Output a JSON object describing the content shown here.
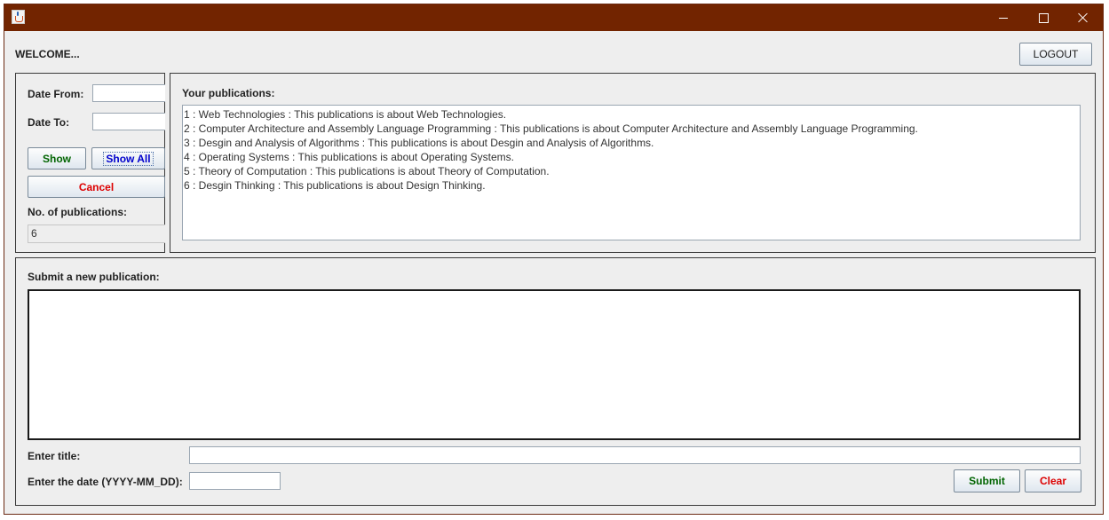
{
  "window": {
    "app_icon": "java-coffee-cup-icon",
    "controls": {
      "minimize": "minimize-icon",
      "maximize": "maximize-icon",
      "close": "close-icon"
    }
  },
  "header": {
    "welcome": "WELCOME...",
    "logout_label": "LOGOUT"
  },
  "filter": {
    "date_from_label": "Date From:",
    "date_from_value": "",
    "date_to_label": "Date To:",
    "date_to_value": "",
    "show_label": "Show",
    "show_all_label": "Show All",
    "cancel_label": "Cancel",
    "count_label": "No. of publications:",
    "count_value": "6"
  },
  "publications": {
    "heading": "Your publications:",
    "items": [
      "1 : Web Technologies : This publications is about Web Technologies.",
      "2 : Computer Architecture and Assembly Language Programming : This publications is about Computer Architecture and Assembly Language Programming.",
      "3 : Desgin and Analysis of Algorithms : This publications is about Desgin and Analysis of Algorithms.",
      "4 : Operating Systems : This publications is about Operating Systems.",
      "5 : Theory of Computation : This publications is about Theory of Computation.",
      "6 : Desgin Thinking : This publications is about Design Thinking."
    ]
  },
  "submit_form": {
    "heading": "Submit a new publication:",
    "body_value": "",
    "title_label": "Enter title:",
    "title_value": "",
    "date_label": "Enter the date (YYYY-MM_DD):",
    "date_value": "",
    "submit_label": "Submit",
    "clear_label": "Clear"
  },
  "colors": {
    "titlebar": "#722400",
    "show_text": "#006400",
    "show_all_text": "#0000cc",
    "cancel_text": "#dd0000",
    "submit_text": "#006400",
    "clear_text": "#dd0000"
  }
}
